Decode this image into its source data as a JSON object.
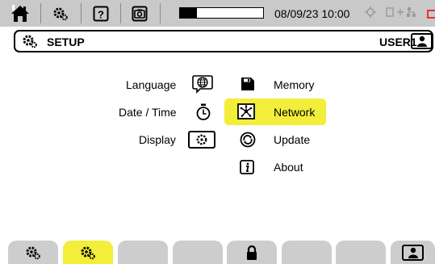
{
  "status_bar": {
    "datetime": "08/09/23 10:00",
    "battery_level": 0.2,
    "icons": [
      "home-icon",
      "gears-icon",
      "help-icon",
      "camera-icon",
      "gps-icon",
      "network-status-icon"
    ]
  },
  "title_bar": {
    "title": "SETUP",
    "user": "USER1"
  },
  "menu": {
    "language": "Language",
    "date_time": "Date / Time",
    "display": "Display",
    "memory": "Memory",
    "network": "Network",
    "update": "Update",
    "about": "About"
  },
  "tabs": [
    {
      "icon": "gears-icon",
      "active": false
    },
    {
      "icon": "gears-icon",
      "active": true
    },
    {
      "icon": "",
      "active": false
    },
    {
      "icon": "",
      "active": false
    },
    {
      "icon": "lock-icon",
      "active": false
    },
    {
      "icon": "",
      "active": false
    },
    {
      "icon": "",
      "active": false
    },
    {
      "icon": "user-icon",
      "active": false
    }
  ],
  "colors": {
    "highlight": "#f3ee3a",
    "status_bar": "#c9c9c9",
    "tab": "#cdcdcd",
    "alert": "#e8322e"
  }
}
